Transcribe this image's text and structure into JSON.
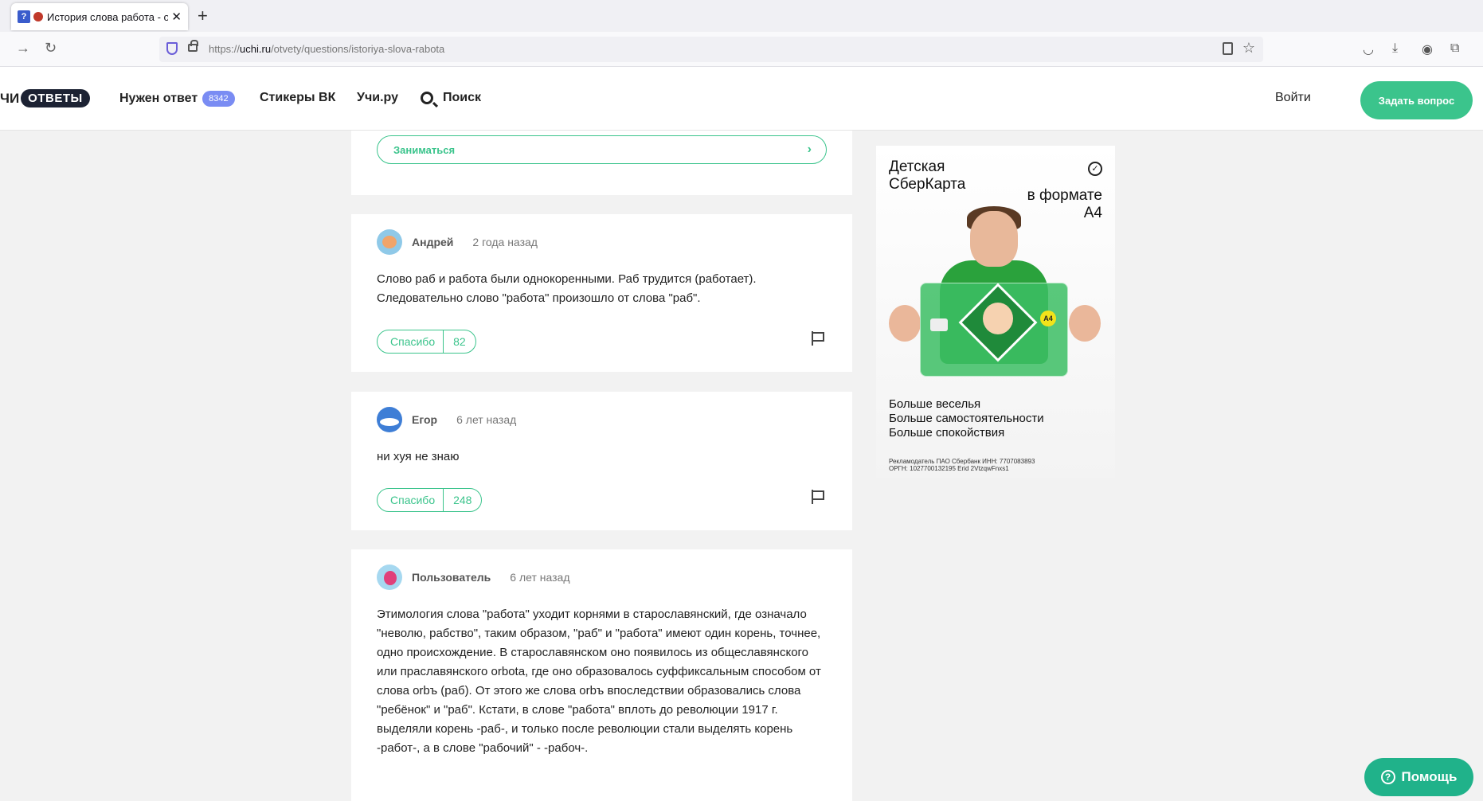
{
  "browser": {
    "tab_title": "История слова работа - от",
    "new_tab_icon": "plus-icon",
    "url_prefix": "https://",
    "url_domain": "uchi.ru",
    "url_path": "/otvety/questions/istoriya-slova-rabota"
  },
  "header": {
    "logo_left": "ЧИ",
    "logo_pill": "ОТВЕТЫ",
    "nav": {
      "need_answer": "Нужен ответ",
      "need_answer_count": "8342",
      "stickers": "Стикеры ВК",
      "uchiru": "Учи.ру",
      "search": "Поиск"
    },
    "login": "Войти",
    "ask_button": "Задать вопрос"
  },
  "study": {
    "label": "Заниматься"
  },
  "answers": [
    {
      "author": "Андрей",
      "time": "2 года назад",
      "text": "Слово раб и работа были однокоренными. Раб трудится (работает). Следовательно слово \"работа\" произошло от слова \"раб\".",
      "thanks_label": "Спасибо",
      "thanks_count": "82"
    },
    {
      "author": "Егор",
      "time": "6 лет назад",
      "text": "ни хуя не знаю",
      "thanks_label": "Спасибо",
      "thanks_count": "248"
    },
    {
      "author": "Пользователь",
      "time": "6 лет назад",
      "text": "Этимология слова \"работа\" уходит корнями в старославянский, где означало \"неволю, рабство\", таким образом, \"раб\" и \"работа\" имеют один корень, точнее, одно происхождение. В старославянском оно появилось из общеславянского или праславянского orbota, где оно образовалось суффиксальным способом от слова orbъ (раб). От этого же слова orbъ впоследствии образовались слова \"ребёнок\" и \"раб\". Кстати, в слове \"работа\" вплоть до революции 1917 г. выделяли корень -раб-, и только после революции стали выделять корень -работ-, а в слове \"рабочий\" - -рабоч-."
    }
  ],
  "ad": {
    "title": "Детская СберКарта",
    "subtitle": "в формате А4",
    "badge": "А4",
    "lines": [
      "Больше веселья",
      "Больше самостоятельности",
      "Больше спокойствия"
    ],
    "legal_1": "Рекламодатель ПАО Сбербанк ИНН: 7707083893",
    "legal_2": "ОРГН: 1027700132195 Erid 2VtzqwFnxs1"
  },
  "help": {
    "label": "Помощь"
  },
  "colors": {
    "accent": "#3bc48c",
    "badge": "#7a8cf3",
    "help": "#20b28a"
  }
}
